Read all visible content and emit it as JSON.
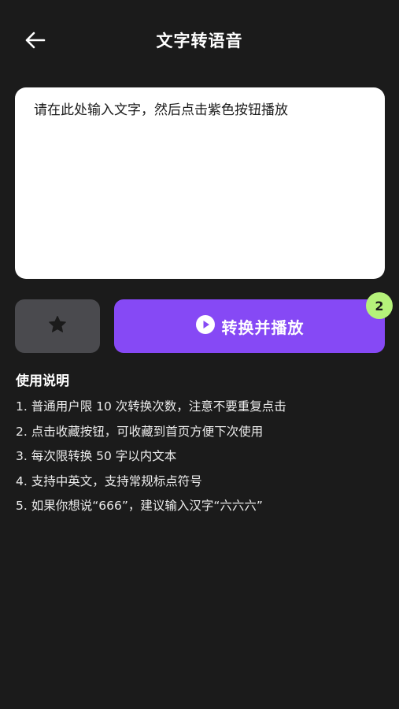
{
  "header": {
    "back_icon": "arrow-left-icon",
    "title": "文字转语音"
  },
  "input": {
    "placeholder": "请在此处输入文字，然后点击紫色按钮播放",
    "value": ""
  },
  "actions": {
    "favorite_icon": "star-icon",
    "play_icon": "play-circle-icon",
    "play_label": "转换并播放",
    "badge_count": "2",
    "accent_color": "#8649f5",
    "badge_color": "#b5f27a"
  },
  "instructions": {
    "heading": "使用说明",
    "items": [
      "1. 普通用户限 10 次转换次数，注意不要重复点击",
      "2. 点击收藏按钮，可收藏到首页方便下次使用",
      "3. 每次限转换 50 字以内文本",
      "4. 支持中英文，支持常规标点符号",
      "5. 如果你想说“666”，建议输入汉字“六六六”"
    ]
  }
}
